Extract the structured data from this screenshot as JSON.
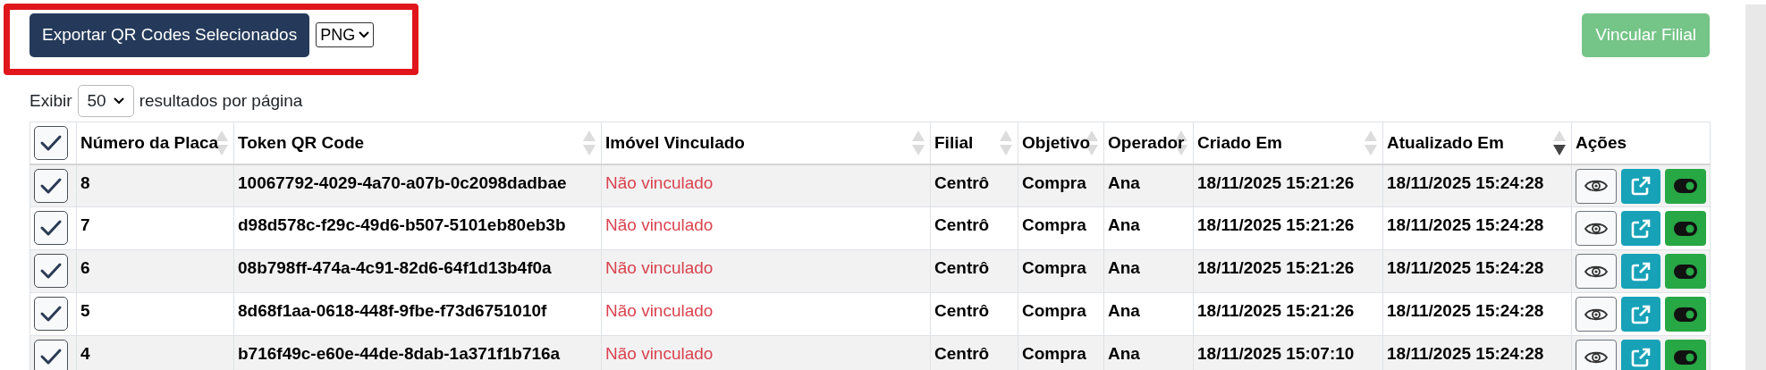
{
  "toolbar": {
    "export_button": "Exportar QR Codes Selecionados",
    "format_select": "PNG",
    "link_button": {
      "label": "Vincular Filial",
      "disabled": true
    }
  },
  "page_size": {
    "prefix": "Exibir",
    "value": "50",
    "suffix": "resultados por página"
  },
  "table": {
    "select_all": {
      "checked": true
    },
    "columns": [
      {
        "label": "Número da Placa",
        "sortable": true,
        "sorted_descending": false
      },
      {
        "label": "Token QR Code",
        "sortable": true,
        "sorted_descending": false
      },
      {
        "label": "Imóvel Vinculado",
        "sortable": true,
        "sorted_descending": false
      },
      {
        "label": "Filial",
        "sortable": true,
        "sorted_descending": false
      },
      {
        "label": "Objetivo",
        "sortable": true,
        "sorted_descending": false
      },
      {
        "label": "Operador",
        "sortable": true,
        "sorted_descending": false
      },
      {
        "label": "Criado Em",
        "sortable": true,
        "sorted_descending": false
      },
      {
        "label": "Atualizado Em",
        "sortable": true,
        "sorted_descending": true
      },
      {
        "label": "Ações"
      }
    ],
    "rows": [
      {
        "checked": true,
        "cells": [
          "8",
          "10067792-4029-4a70-a07b-0c2098dadbae",
          "Não vinculado",
          "Centrô",
          "Compra",
          "Ana",
          "18/11/2025 15:21:26",
          "18/11/2025 15:24:28"
        ]
      },
      {
        "checked": true,
        "cells": [
          "7",
          "d98d578c-f29c-49d6-b507-5101eb80eb3b",
          "Não vinculado",
          "Centrô",
          "Compra",
          "Ana",
          "18/11/2025 15:21:26",
          "18/11/2025 15:24:28"
        ]
      },
      {
        "checked": true,
        "cells": [
          "6",
          "08b798ff-474a-4c91-82d6-64f1d13b4f0a",
          "Não vinculado",
          "Centrô",
          "Compra",
          "Ana",
          "18/11/2025 15:21:26",
          "18/11/2025 15:24:28"
        ]
      },
      {
        "checked": true,
        "cells": [
          "5",
          "8d68f1aa-0618-448f-9fbe-f73d6751010f",
          "Não vinculado",
          "Centrô",
          "Compra",
          "Ana",
          "18/11/2025 15:21:26",
          "18/11/2025 15:24:28"
        ]
      },
      {
        "checked": true,
        "cells": [
          "4",
          "b716f49c-e60e-44de-8dab-1a371f1b716a",
          "Não vinculado",
          "Centrô",
          "Compra",
          "Ana",
          "18/11/2025 15:07:10",
          "18/11/2025 15:24:28"
        ]
      }
    ]
  }
}
